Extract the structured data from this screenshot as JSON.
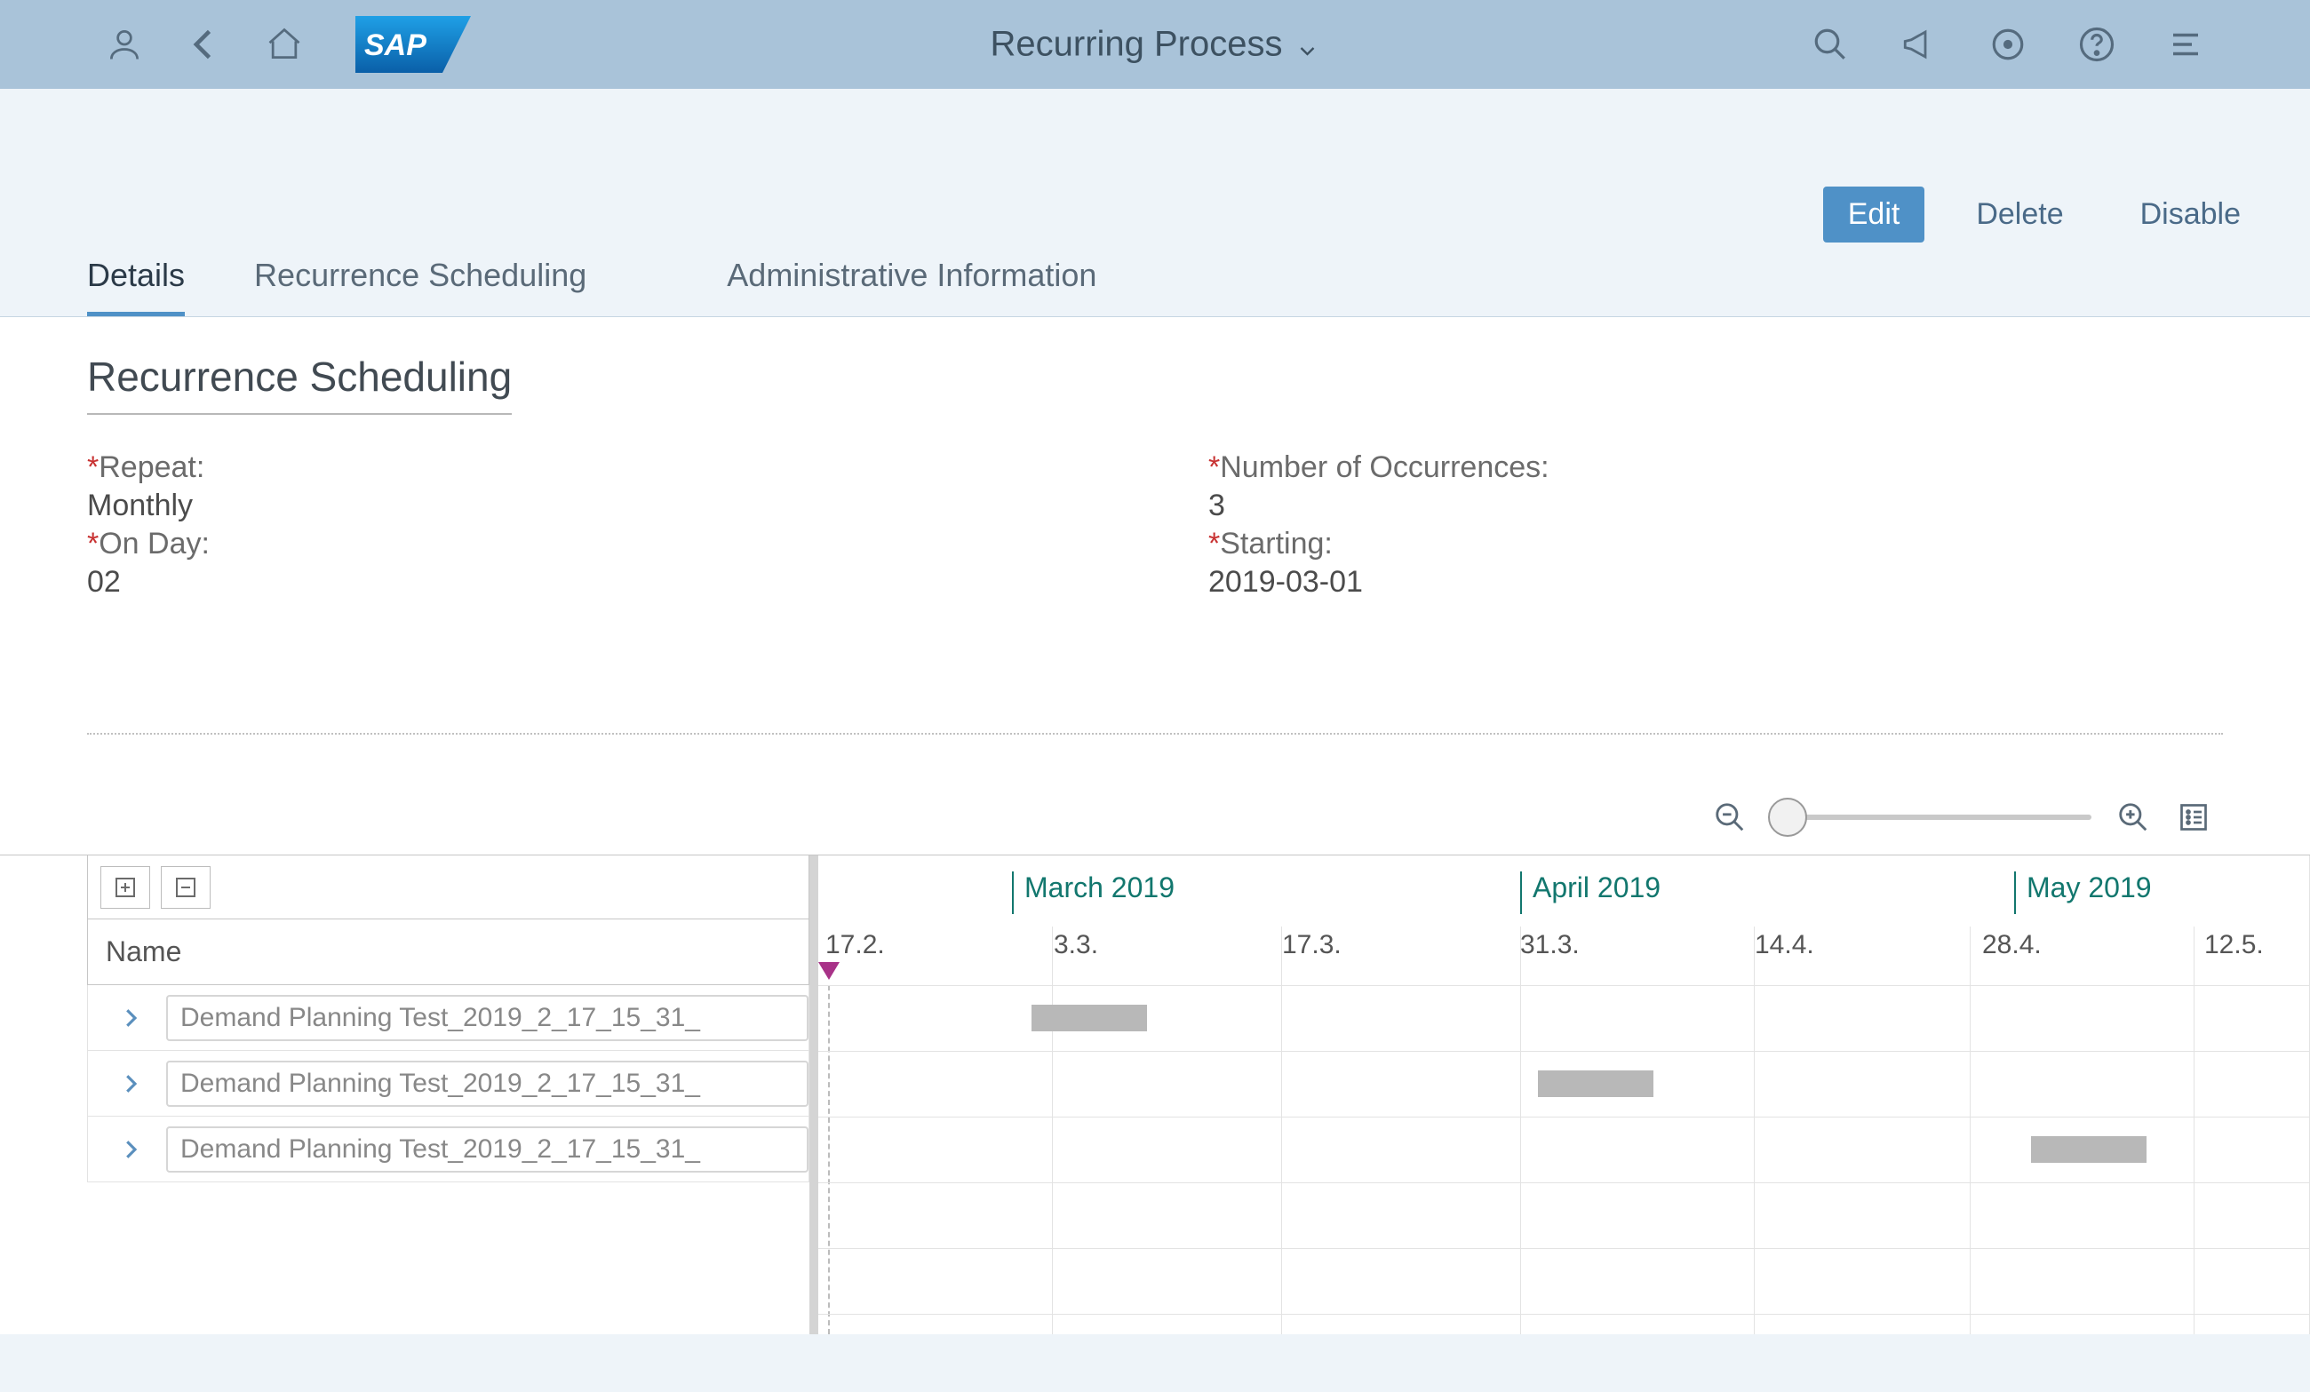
{
  "header": {
    "title": "Recurring Process",
    "logo_text": "SAP"
  },
  "actions": {
    "edit": "Edit",
    "delete": "Delete",
    "disable": "Disable"
  },
  "tabs": {
    "details": "Details",
    "recurrence": "Recurrence Scheduling",
    "admin": "Administrative Information"
  },
  "section": {
    "title": "Recurrence Scheduling"
  },
  "fields": {
    "repeat_label": "Repeat:",
    "repeat_value": "Monthly",
    "onday_label": "On Day:",
    "onday_value": "02",
    "numocc_label": "Number of Occurrences:",
    "numocc_value": "3",
    "starting_label": "Starting:",
    "starting_value": "2019-03-01"
  },
  "gantt": {
    "left": {
      "name_header": "Name",
      "rows": [
        "Demand Planning Test_2019_2_17_15_31_",
        "Demand Planning Test_2019_2_17_15_31_",
        "Demand Planning Test_2019_2_17_15_31_"
      ]
    },
    "months": {
      "m1": "March 2019",
      "m2": "April 2019",
      "m3": "May 2019"
    },
    "dates": {
      "d0": "17.2.",
      "d1": "3.3.",
      "d2": "17.3.",
      "d3": "31.3.",
      "d4": "14.4.",
      "d5": "28.4.",
      "d6": "12.5."
    }
  }
}
